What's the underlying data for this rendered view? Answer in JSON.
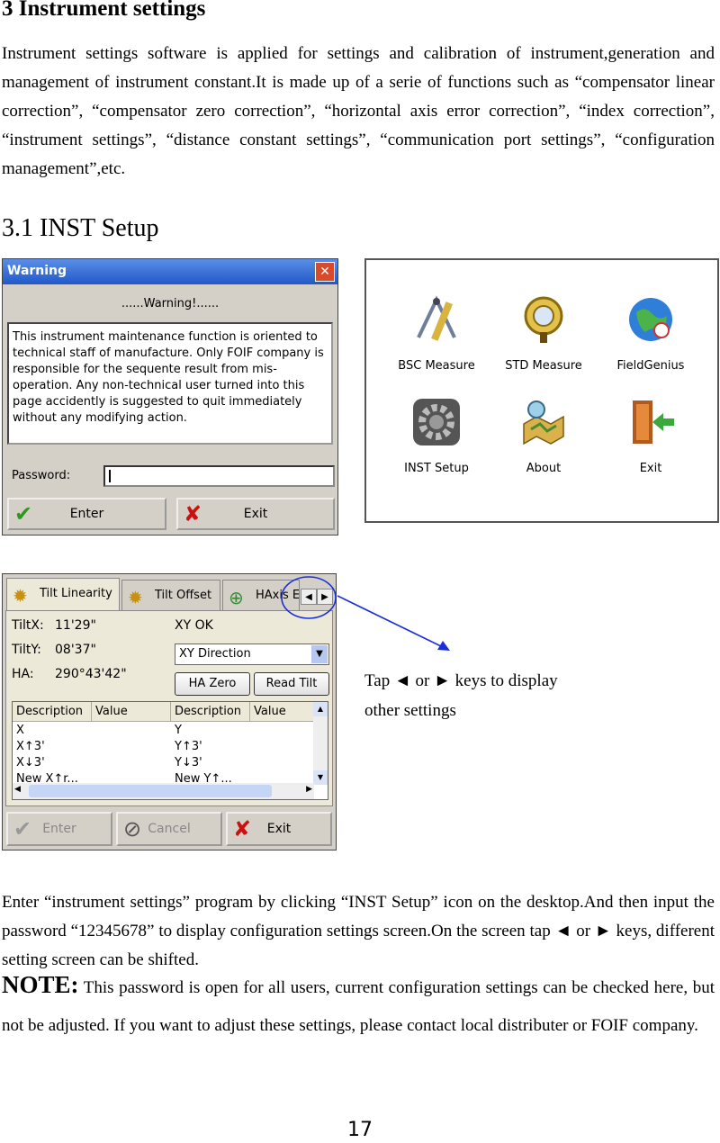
{
  "heading": "3 Instrument settings",
  "intro": "Instrument settings software is applied for settings and calibration of instrument,generation and management of instrument constant.It is made up of a serie of functions such as “compensator linear correction”, “compensator zero correction”, “horizontal axis error correction”, “index correction”, “instrument settings”, “distance constant settings”, “communication port settings”, “configuration management”,etc.",
  "subheading": "3.1 INST Setup",
  "warning_dialog": {
    "title": "Warning",
    "headline": "......Warning!......",
    "message": "This instrument maintenance function is oriented to technical staff of manufacture. Only FOIF company is responsible for the sequente result from mis-operation. Any non-technical user turned into this page accidently is suggested to quit immediately without any modifying action.",
    "password_label": "Password:",
    "enter_label": "Enter",
    "exit_label": "Exit"
  },
  "desktop": {
    "icons": [
      {
        "label": "BSC Measure",
        "icon": "compass-ruler-icon"
      },
      {
        "label": "STD Measure",
        "icon": "magnifier-icon"
      },
      {
        "label": "FieldGenius",
        "icon": "globe-icon"
      },
      {
        "label": "INST Setup",
        "icon": "gear-icon"
      },
      {
        "label": "About",
        "icon": "map-icon"
      },
      {
        "label": "Exit",
        "icon": "door-exit-icon"
      }
    ]
  },
  "settings_dialog": {
    "tabs": [
      "Tilt Linearity",
      "Tilt Offset",
      "HAxis E"
    ],
    "tilt_x_label": "TiltX:",
    "tilt_x_value": "11'29\"",
    "tilt_y_label": "TiltY:",
    "tilt_y_value": "08'37\"",
    "ha_label": "HA:",
    "ha_value": "290°43'42\"",
    "xy_status": "XY OK",
    "direction_select": "XY Direction",
    "ha_zero_label": "HA Zero",
    "read_tilt_label": "Read Tilt",
    "columns": [
      "Description",
      "Value",
      "Description",
      "Value"
    ],
    "rows_left": [
      "X",
      "X↑3'",
      "X↓3'",
      "New X↑r..."
    ],
    "rows_right": [
      "Y",
      "Y↑3'",
      "Y↓3'",
      "New Y↑..."
    ],
    "enter_label": "Enter",
    "cancel_label": "Cancel",
    "exit_label": "Exit"
  },
  "callout_line1": "Tap ◄ or ► keys to display",
  "callout_line2": "other settings",
  "body_text": "Enter “instrument settings” program by clicking “INST Setup” icon on the desktop.And then input the password “12345678” to display configuration settings screen.On the screen tap ◄ or ► keys, different setting screen can be shifted.",
  "note_label": "NOTE:",
  "note_text": " This password is open for all users, current configuration settings can be checked here, but not be adjusted. If you want to adjust these settings, please contact local distributer or FOIF company.",
  "page_number": "17",
  "colors": {
    "title_bar": "#2a63d0",
    "callout_line": "#1a2fd6",
    "exit_icon": "#cc1010",
    "check_icon": "#2a9a1a"
  }
}
